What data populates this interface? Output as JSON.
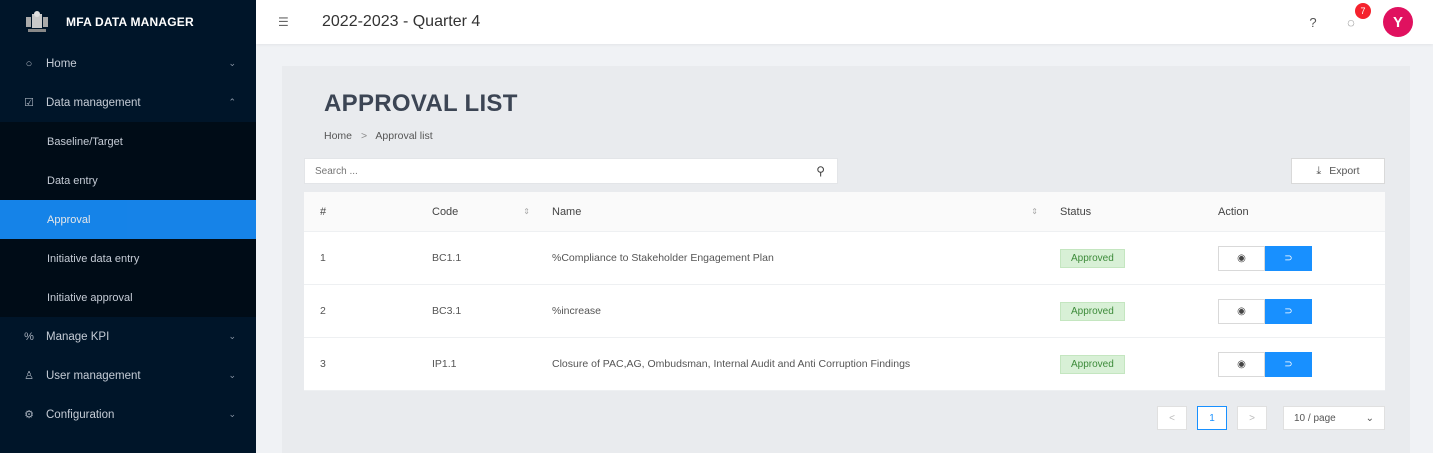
{
  "app": {
    "title": "MFA DATA MANAGER"
  },
  "header": {
    "period": "2022-2023 - Quarter 4",
    "notification_count": "7",
    "avatar_letter": "Y"
  },
  "sidebar": {
    "items": [
      {
        "label": "Home",
        "icon": "home-icon"
      },
      {
        "label": "Data management",
        "icon": "edit-icon"
      },
      {
        "label": "Manage KPI",
        "icon": "kpi-icon"
      },
      {
        "label": "User management",
        "icon": "user-icon"
      },
      {
        "label": "Configuration",
        "icon": "gear-icon"
      }
    ],
    "sub_items": [
      {
        "label": "Baseline/Target"
      },
      {
        "label": "Data entry"
      },
      {
        "label": "Approval"
      },
      {
        "label": "Initiative data entry"
      },
      {
        "label": "Initiative approval"
      }
    ]
  },
  "page": {
    "title": "APPROVAL LIST",
    "breadcrumb": {
      "home": "Home",
      "current": "Approval list"
    },
    "search_placeholder": "Search ...",
    "export_label": "Export"
  },
  "table": {
    "headers": {
      "num": "#",
      "code": "Code",
      "name": "Name",
      "status": "Status",
      "action": "Action"
    },
    "rows": [
      {
        "num": "1",
        "code": "BC1.1",
        "name": "%Compliance to Stakeholder Engagement Plan",
        "status": "Approved"
      },
      {
        "num": "2",
        "code": "BC3.1",
        "name": "%increase",
        "status": "Approved"
      },
      {
        "num": "3",
        "code": "IP1.1",
        "name": "Closure of PAC,AG, Ombudsman, Internal Audit and Anti Corruption Findings",
        "status": "Approved"
      }
    ]
  },
  "pagination": {
    "prev": "<",
    "current": "1",
    "next": ">",
    "page_size": "10 / page"
  },
  "colors": {
    "sidebar_bg": "#001529",
    "accent": "#1890ff",
    "avatar": "#e0115f",
    "approved_bg": "#d8f0d6"
  }
}
